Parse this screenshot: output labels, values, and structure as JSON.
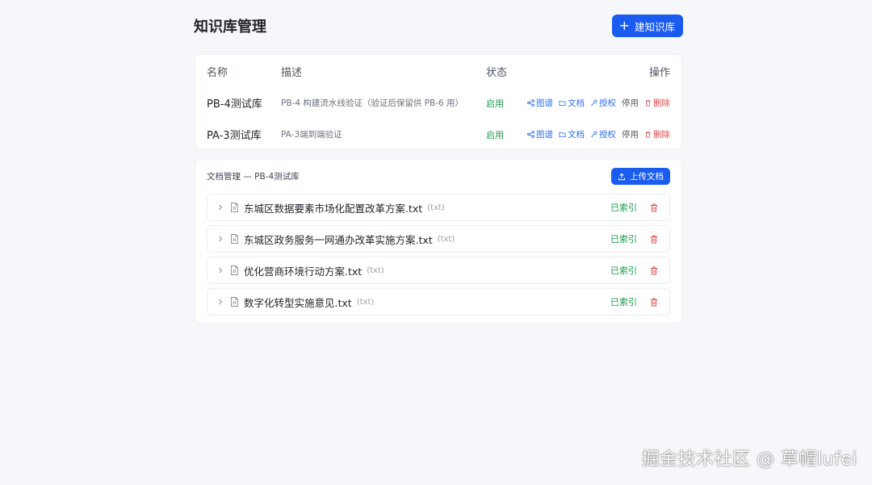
{
  "header": {
    "title": "知识库管理",
    "create_label": "建知识库"
  },
  "kb_table": {
    "columns": [
      "名称",
      "描述",
      "状态",
      "操作"
    ],
    "rows": [
      {
        "name": "PB-4测试库",
        "description": "PB-4 构建流水线验证（验证后保留供 PB-6 用）",
        "status": "启用",
        "ops": {
          "graph": "图谱",
          "docs": "文档",
          "auth": "授权",
          "disable": "停用",
          "delete": "删除"
        }
      },
      {
        "name": "PA-3测试库",
        "description": "PA-3端到端验证",
        "status": "启用",
        "ops": {
          "graph": "图谱",
          "docs": "文档",
          "auth": "授权",
          "disable": "停用",
          "delete": "删除"
        }
      }
    ]
  },
  "doc_panel": {
    "title": "文档管理 — PB-4测试库",
    "upload_label": "上传文档",
    "items": [
      {
        "name": "东城区数据要素市场化配置改革方案.txt",
        "type": "(txt)",
        "status": "已索引"
      },
      {
        "name": "东城区政务服务一网通办改革实施方案.txt",
        "type": "(txt)",
        "status": "已索引"
      },
      {
        "name": "优化营商环境行动方案.txt",
        "type": "(txt)",
        "status": "已索引"
      },
      {
        "name": "数字化转型实施意见.txt",
        "type": "(txt)",
        "status": "已索引"
      }
    ]
  },
  "watermark": "掘金技术社区 @ 草帽lufei",
  "colors": {
    "primary": "#1a5cf0",
    "link": "#2b6ff0",
    "success": "#1a9c4b",
    "danger": "#e5484d",
    "background": "#f6f7fb"
  },
  "icons": [
    "plus-icon",
    "share-icon",
    "folder-icon",
    "key-icon",
    "trash-icon",
    "upload-icon",
    "chevron-right-icon",
    "file-icon"
  ]
}
